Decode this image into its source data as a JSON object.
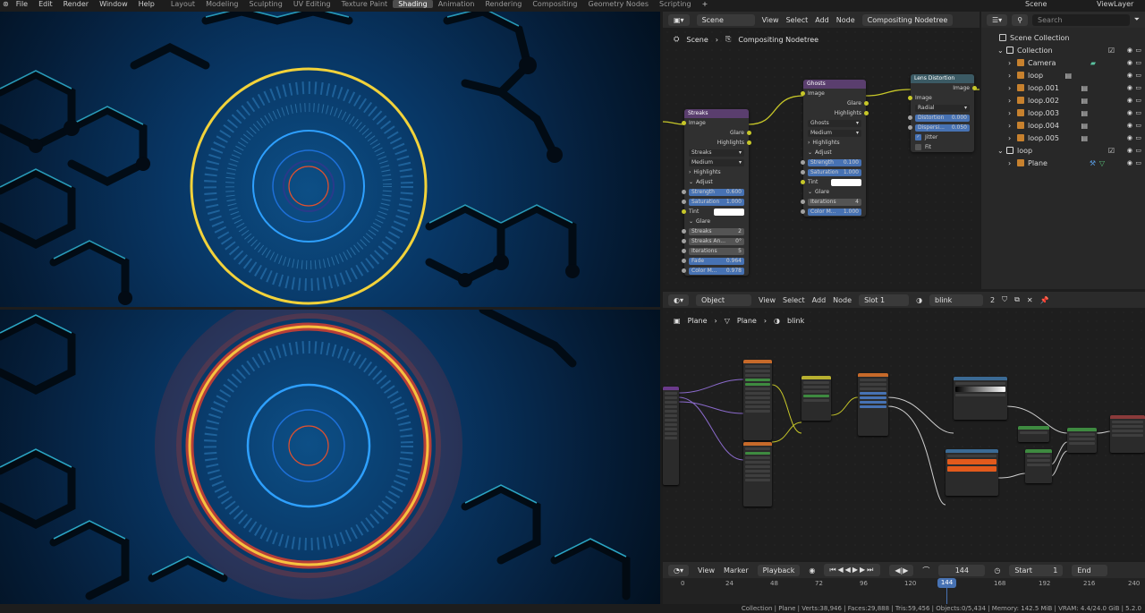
{
  "topbar": {
    "menus": [
      "File",
      "Edit",
      "Render",
      "Window",
      "Help"
    ],
    "workspaces": [
      "Layout",
      "Modeling",
      "Sculpting",
      "UV Editing",
      "Texture Paint",
      "Shading",
      "Animation",
      "Rendering",
      "Compositing",
      "Geometry Nodes",
      "Scripting"
    ],
    "active_workspace": "Shading",
    "add_label": "+",
    "scene": "Scene",
    "view_layer": "ViewLayer"
  },
  "compositor": {
    "header": {
      "editor": "Scene",
      "menus": [
        "View",
        "Select",
        "Add",
        "Node"
      ],
      "nodetree": "Compositing Nodetree"
    },
    "breadcrumb": {
      "scene": "Scene",
      "tree": "Compositing Nodetree"
    },
    "streaks": {
      "title": "Streaks",
      "input": "Image",
      "outputs": [
        "Glare",
        "Highlights"
      ],
      "type": "Streaks",
      "quality": "Medium",
      "highlights": "Highlights",
      "adjust": "Adjust",
      "strength": {
        "label": "Strength",
        "value": "0.600"
      },
      "saturation": {
        "label": "Saturation",
        "value": "1.000"
      },
      "tint": "Tint",
      "glare": "Glare",
      "streaks": {
        "label": "Streaks",
        "value": "2"
      },
      "angle": {
        "label": "Streaks An...",
        "value": "0°"
      },
      "iterations": {
        "label": "Iterations",
        "value": "5"
      },
      "fade": {
        "label": "Fade",
        "value": "0.964"
      },
      "colormod": {
        "label": "Color M...",
        "value": "0.978"
      }
    },
    "ghosts": {
      "title": "Ghosts",
      "input": "Image",
      "outputs": [
        "Glare",
        "Highlights"
      ],
      "type": "Ghosts",
      "quality": "Medium",
      "highlights": "Highlights",
      "adjust": "Adjust",
      "strength": {
        "label": "Strength",
        "value": "0.100"
      },
      "saturation": {
        "label": "Saturation",
        "value": "1.000"
      },
      "tint": "Tint",
      "glare": "Glare",
      "iterations": {
        "label": "Iterations",
        "value": "4"
      },
      "colormod": {
        "label": "Color M...",
        "value": "1.000"
      }
    },
    "lens": {
      "title": "Lens Distortion",
      "output": "Image",
      "input": "Image",
      "type": "Radial",
      "distortion": {
        "label": "Distortion",
        "value": "0.000"
      },
      "dispersion": {
        "label": "Dispersi...",
        "value": "0.050"
      },
      "jitter": "Jitter",
      "fit": "Fit"
    }
  },
  "outliner": {
    "search_placeholder": "Search",
    "root": "Scene Collection",
    "collection": "Collection",
    "items": [
      "Camera",
      "loop",
      "loop.001",
      "loop.002",
      "loop.003",
      "loop.004",
      "loop.005"
    ],
    "loop_collection": "loop",
    "plane": "Plane"
  },
  "shader": {
    "header": {
      "mode": "Object",
      "menus": [
        "View",
        "Select",
        "Add",
        "Node"
      ],
      "slot": "Slot 1",
      "material": "blink",
      "users": "2"
    },
    "breadcrumb": [
      "Plane",
      "Plane",
      "blink"
    ]
  },
  "timeline": {
    "menus": [
      "View",
      "Marker",
      "Playback"
    ],
    "current_frame": "144",
    "start_label": "Start",
    "start": "1",
    "end_label": "End",
    "ticks": [
      "0",
      "24",
      "48",
      "72",
      "96",
      "120",
      "144",
      "168",
      "192",
      "216",
      "240"
    ]
  },
  "statusbar": {
    "text": "Collection | Plane | Verts:38,946 | Faces:29,888 | Tris:59,456 | Objects:0/5,434 | Memory: 142.5 MiB | VRAM: 4.4/24.0 GiB | 5.2.0"
  },
  "colors": {
    "accent": "#4772b3",
    "yellow_ring": "#f2d23a",
    "red_glow": "#e2402c",
    "socket": "#c7c729"
  }
}
